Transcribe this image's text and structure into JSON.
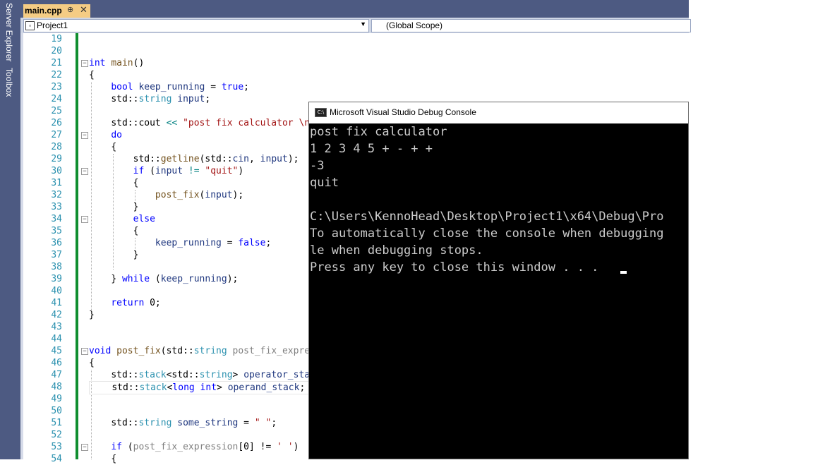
{
  "side_tabs": [
    "Server Explorer",
    "Toolbox"
  ],
  "editor_tab": {
    "filename": "main.cpp",
    "pin": "⊕",
    "close": "✕"
  },
  "navbar": {
    "project": "Project1",
    "scope": "(Global Scope)"
  },
  "line_numbers": [
    "19",
    "20",
    "21",
    "22",
    "23",
    "24",
    "25",
    "26",
    "27",
    "28",
    "29",
    "30",
    "31",
    "32",
    "33",
    "34",
    "35",
    "36",
    "37",
    "38",
    "39",
    "40",
    "41",
    "42",
    "43",
    "44",
    "45",
    "46",
    "47",
    "48",
    "49",
    "50",
    "51",
    "52",
    "53",
    "54"
  ],
  "code": {
    "l21_kw": "int",
    "l21_fn": "main",
    "l21_rest": "()",
    "l22": "{",
    "l23_kw": "bool",
    "l23_var": "keep_running",
    "l23_mid": " = ",
    "l23_val": "true",
    "l23_end": ";",
    "l24_ns": "std",
    "l24_sep": "::",
    "l24_ty": "string",
    "l24_var": "input",
    "l24_end": ";",
    "l26_ns": "std",
    "l26_sep": "::",
    "l26_cout": "cout",
    "l26_op": " << ",
    "l26_str": "\"post fix calculator \\n\"",
    "l27_kw": "do",
    "l28": "{",
    "l29_ns": "std",
    "l29_sep": "::",
    "l29_fn": "getline",
    "l29_p1": "(",
    "l29_ns2": "std",
    "l29_sep2": "::",
    "l29_cin": "cin",
    "l29_comma": ", ",
    "l29_var": "input",
    "l29_end": ");",
    "l30_kw": "if",
    "l30_p": " (",
    "l30_var": "input",
    "l30_op": " != ",
    "l30_str": "\"quit\"",
    "l30_end": ")",
    "l31": "{",
    "l32_fn": "post_fix",
    "l32_p": "(",
    "l32_var": "input",
    "l32_end": ");",
    "l33": "}",
    "l34_kw": "else",
    "l35": "{",
    "l36_var": "keep_running",
    "l36_mid": " = ",
    "l36_val": "false",
    "l36_end": ";",
    "l37": "}",
    "l39_b": "} ",
    "l39_kw": "while",
    "l39_p": " (",
    "l39_var": "keep_running",
    "l39_end": ");",
    "l41_kw": "return",
    "l41_rest": " 0;",
    "l42": "}",
    "l45_kw": "void",
    "l45_fn": "post_fix",
    "l45_p": "(",
    "l45_ns": "std",
    "l45_sep": "::",
    "l45_ty": "string",
    "l45_var": "post_fix_expres",
    "l46": "{",
    "l47_ns": "std",
    "l47_sep": "::",
    "l47_ty": "stack",
    "l47_lt": "<",
    "l47_ns2": "std",
    "l47_sep2": "::",
    "l47_ty2": "string",
    "l47_gt": "> ",
    "l47_var": "operator_stack",
    "l48_ns": "std",
    "l48_sep": "::",
    "l48_ty": "stack",
    "l48_lt": "<",
    "l48_kw": "long int",
    "l48_gt": "> ",
    "l48_var": "operand_stack",
    "l48_end": ";",
    "l51_ns": "std",
    "l51_sep": "::",
    "l51_ty": "string",
    "l51_var": "some_string",
    "l51_mid": " = ",
    "l51_str": "\" \"",
    "l51_end": ";",
    "l53_kw": "if",
    "l53_p": " (",
    "l53_var": "post_fix_expression",
    "l53_idx": "[0] != ",
    "l53_chr": "' '",
    "l53_end": ")",
    "l54": "{"
  },
  "console": {
    "title": "Microsoft Visual Studio Debug Console",
    "icon_label": "C:\\",
    "lines": [
      "post fix calculator",
      "1 2 3 4 5 + - + +",
      "-3",
      "quit",
      "",
      "C:\\Users\\KennoHead\\Desktop\\Project1\\x64\\Debug\\Pro",
      "To automatically close the console when debugging",
      "le when debugging stops.",
      "Press any key to close this window . . ."
    ]
  },
  "colors": {
    "keyword": "#0000ff",
    "type": "#2b91af",
    "string": "#a31515",
    "function": "#74531f",
    "variable": "#1f377f",
    "change_bar": "#108e2f",
    "tab_active": "#f5cc84",
    "chrome": "#4d5a82"
  }
}
